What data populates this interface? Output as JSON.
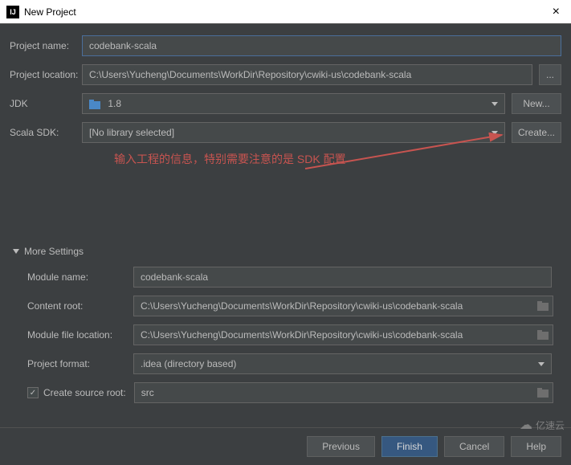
{
  "window": {
    "title": "New Project"
  },
  "fields": {
    "project_name_label": "Project name:",
    "project_name_value": "codebank-scala",
    "project_location_label": "Project location:",
    "project_location_value": "C:\\Users\\Yucheng\\Documents\\WorkDir\\Repository\\cwiki-us\\codebank-scala",
    "jdk_label": "JDK",
    "jdk_value": "1.8",
    "jdk_new_btn": "New...",
    "scala_sdk_label": "Scala SDK:",
    "scala_sdk_value": "[No library selected]",
    "scala_sdk_create_btn": "Create...",
    "dots": "..."
  },
  "annotation": {
    "text": "输入工程的信息，特别需要注意的是 SDK 配置"
  },
  "more": {
    "header": "More Settings",
    "module_name_label": "Module name:",
    "module_name_value": "codebank-scala",
    "content_root_label": "Content root:",
    "content_root_value": "C:\\Users\\Yucheng\\Documents\\WorkDir\\Repository\\cwiki-us\\codebank-scala",
    "module_file_loc_label": "Module file location:",
    "module_file_loc_value": "C:\\Users\\Yucheng\\Documents\\WorkDir\\Repository\\cwiki-us\\codebank-scala",
    "project_format_label": "Project format:",
    "project_format_value": ".idea (directory based)",
    "create_source_root_label": "Create source root:",
    "create_source_root_checked": "✓",
    "src_value": "src"
  },
  "buttons": {
    "previous": "Previous",
    "finish": "Finish",
    "cancel": "Cancel",
    "help": "Help"
  },
  "watermark": {
    "text": "亿速云"
  }
}
